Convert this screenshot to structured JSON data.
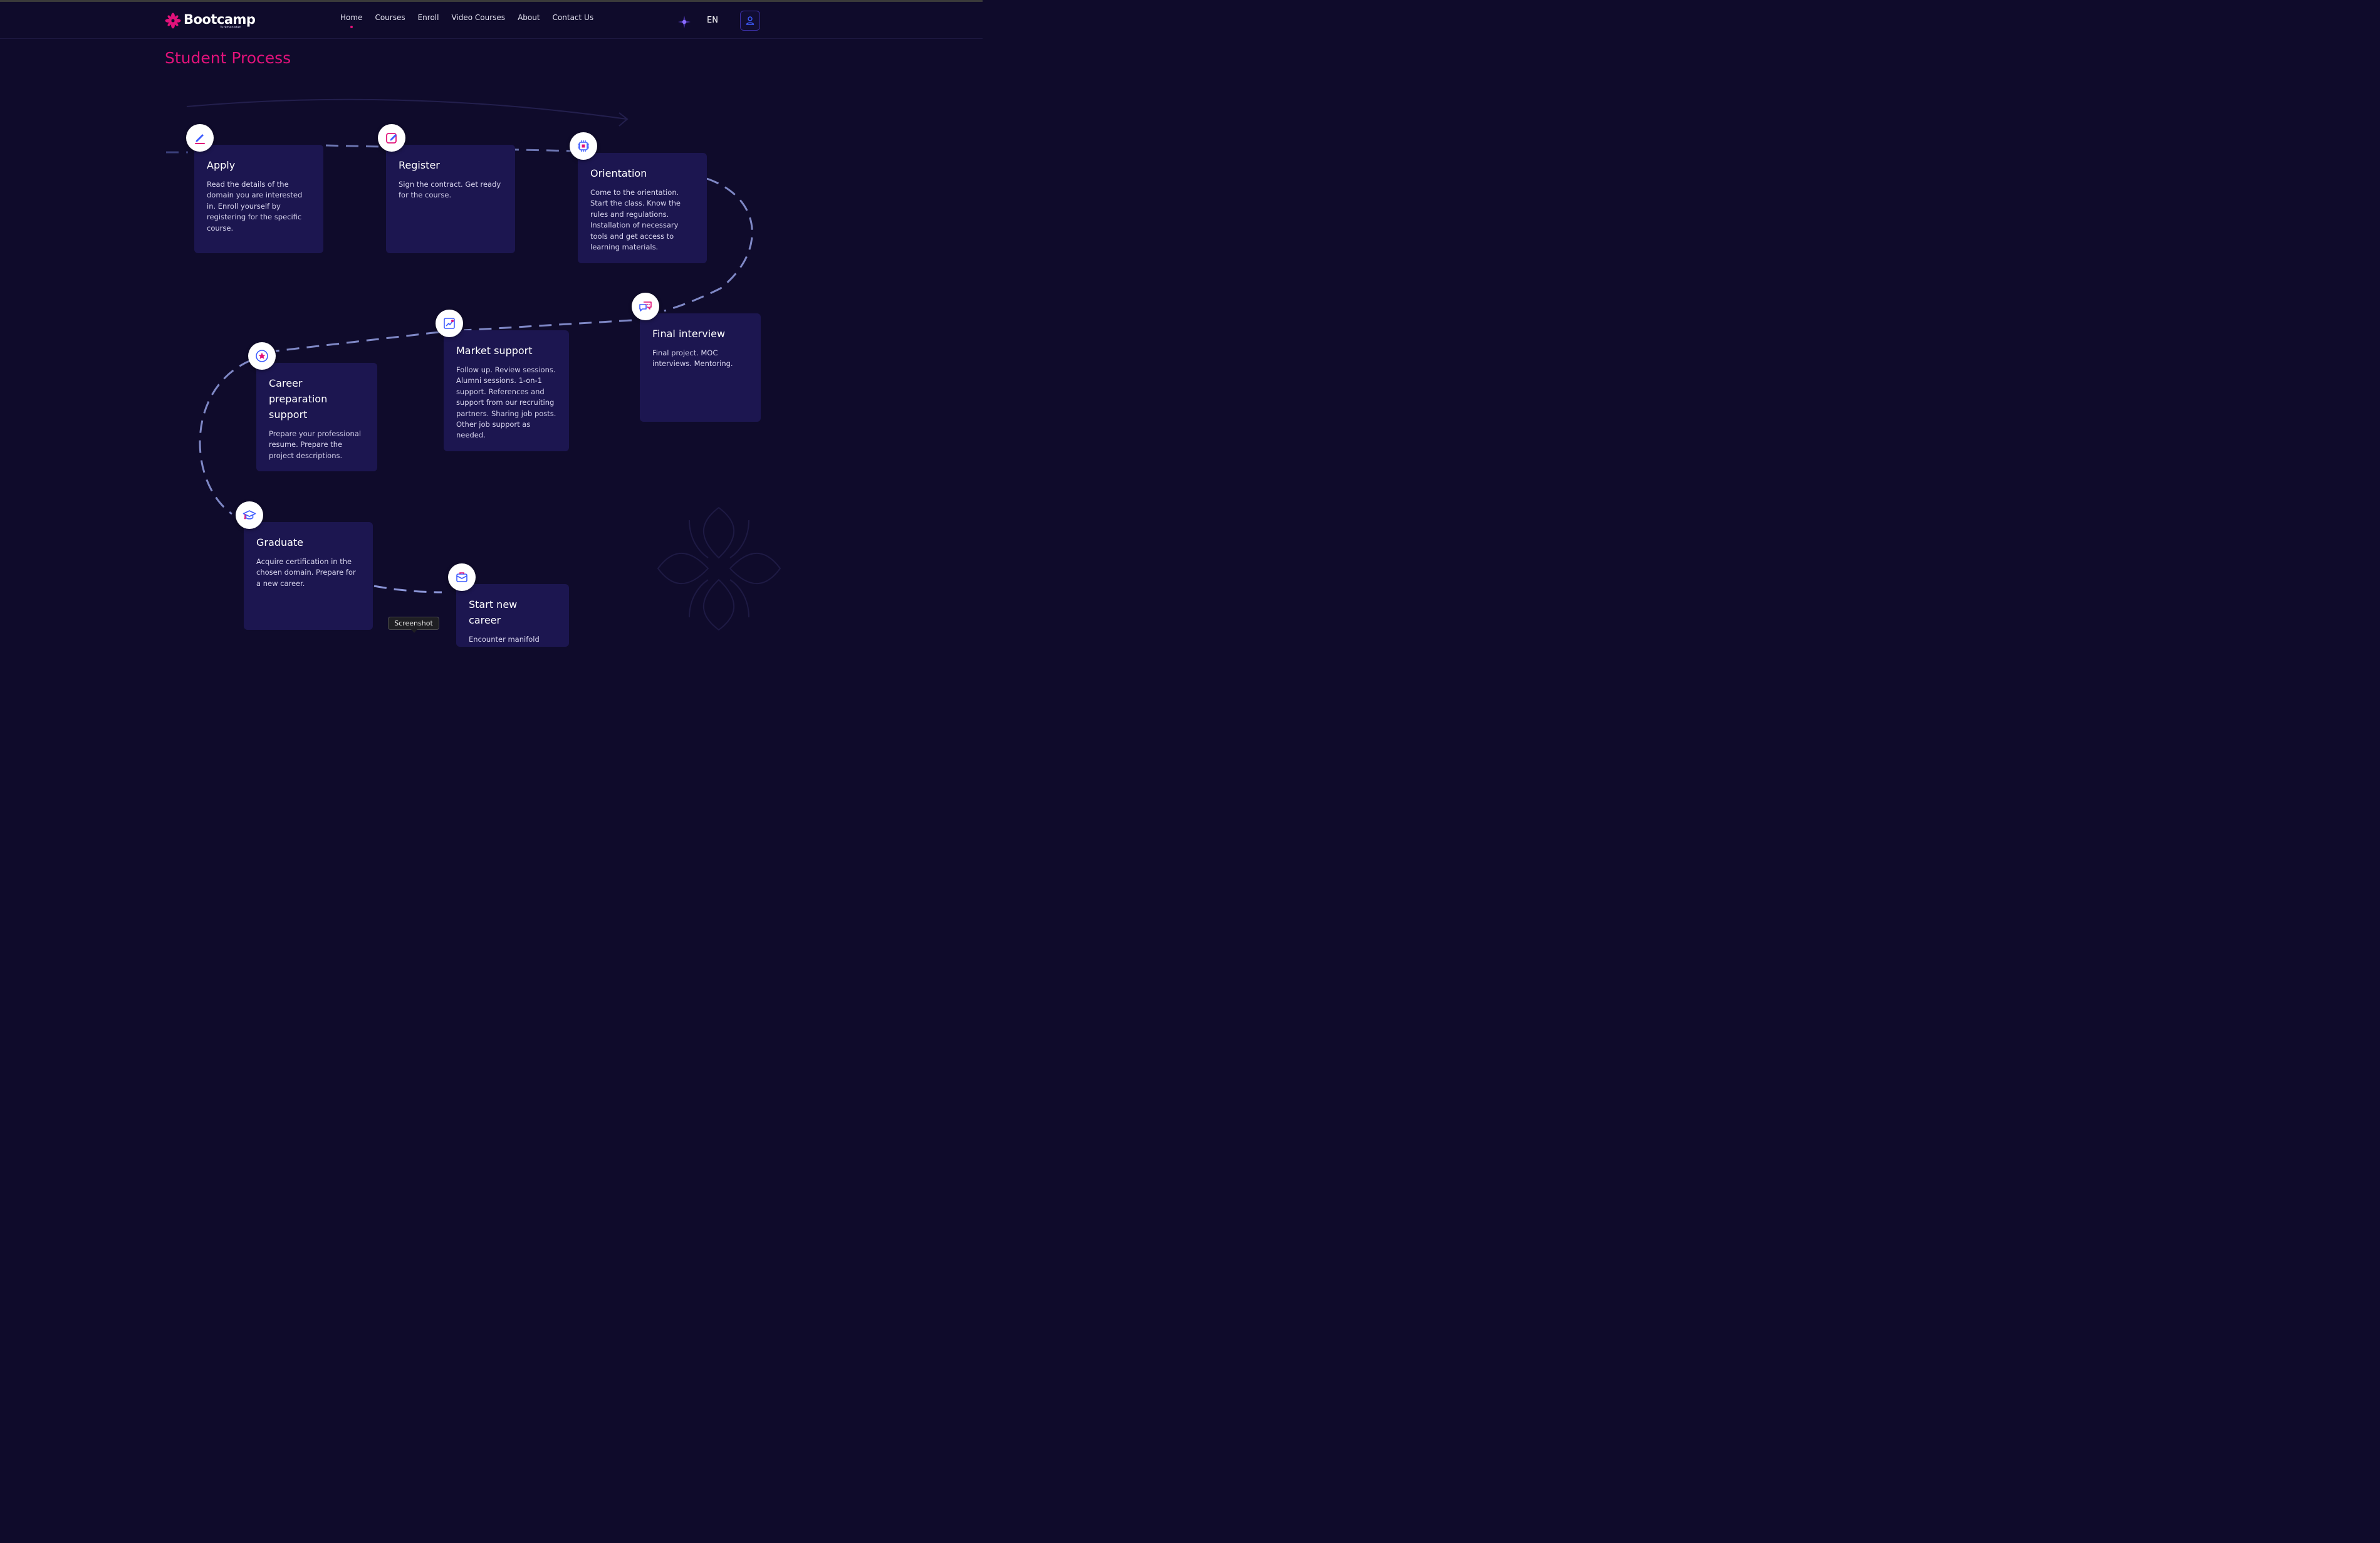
{
  "header": {
    "logo_text": "Bootcamp",
    "logo_sub": "Turkmenistan",
    "nav": [
      {
        "label": "Home",
        "active": true
      },
      {
        "label": "Courses"
      },
      {
        "label": "Enroll"
      },
      {
        "label": "Video Courses"
      },
      {
        "label": "About"
      },
      {
        "label": "Contact Us"
      }
    ],
    "language": "EN"
  },
  "page": {
    "title": "Student Process",
    "accent_color": "#e1127a",
    "card_color": "#1c1650",
    "background_color": "#0f0b2b"
  },
  "steps": [
    {
      "title": "Apply",
      "icon": "pen-icon",
      "description": "Read the details of the domain you are interested in. Enroll yourself by registering for the specific course."
    },
    {
      "title": "Register",
      "icon": "edit-icon",
      "description": "Sign the contract. Get ready for the course."
    },
    {
      "title": "Orientation",
      "icon": "chip-icon",
      "description": "Come to the orientation. Start the class. Know the rules and regulations. Installation of necessary tools and get access to learning materials."
    },
    {
      "title": "Final interview",
      "icon": "chat-icon",
      "description": "Final project. MOC interviews. Mentoring."
    },
    {
      "title": "Market support",
      "icon": "chart-icon",
      "description": "Follow up. Review sessions. Alumni sessions. 1-on-1 support. References and support from our recruiting partners. Sharing job posts. Other job support as needed."
    },
    {
      "title": "Career preparation support",
      "icon": "star-icon",
      "description": "Prepare your professional resume. Prepare the project descriptions."
    },
    {
      "title": "Graduate",
      "icon": "graduation-cap-icon",
      "description": "Acquire certification in the chosen domain. Prepare for a new career."
    },
    {
      "title": "Start new career",
      "icon": "briefcase-icon",
      "description": "Encounter manifold"
    }
  ],
  "tooltip": "Screenshot"
}
